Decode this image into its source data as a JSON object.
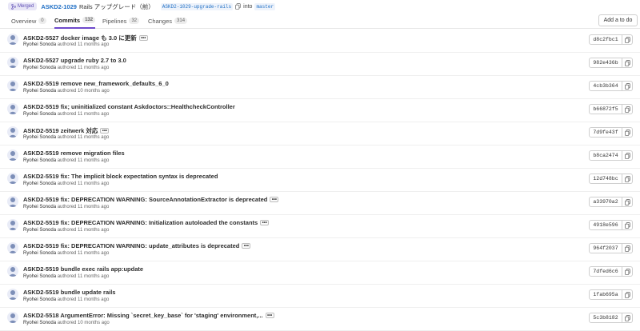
{
  "header": {
    "status_label": "Merged",
    "mr_id": "ASKD2-1029",
    "mr_title": "Rails アップグレード（前）",
    "source_branch": "ASKD2-1029-upgrade-rails",
    "into_label": "into",
    "target_branch": "master"
  },
  "tabs": [
    {
      "label": "Overview",
      "count": "0"
    },
    {
      "label": "Commits",
      "count": "132"
    },
    {
      "label": "Pipelines",
      "count": "32"
    },
    {
      "label": "Changes",
      "count": "314"
    }
  ],
  "todo_button": "Add a to do",
  "commits": [
    {
      "title": "ASKD2-5527 docker image も 3.0 に更新",
      "author": "Ryohei Sonoda",
      "time": "authored 11 months ago",
      "sha": "d8c2fbc1",
      "ellipsis": true
    },
    {
      "title": "ASKD2-5527 upgrade ruby 2.7 to 3.0",
      "author": "Ryohei Sonoda",
      "time": "authored 11 months ago",
      "sha": "982e436b",
      "ellipsis": false
    },
    {
      "title": "ASKD2-5519 remove new_framework_defaults_6_0",
      "author": "Ryohei Sonoda",
      "time": "authored 10 months ago",
      "sha": "4cb3b364",
      "ellipsis": false
    },
    {
      "title": "ASKD2-5519 fix; uninitialized constant Askdoctors::HealthcheckController",
      "author": "Ryohei Sonoda",
      "time": "authored 11 months ago",
      "sha": "b66872f5",
      "ellipsis": false
    },
    {
      "title": "ASKD2-5519 zeitwerk 対応",
      "author": "Ryohei Sonoda",
      "time": "authored 11 months ago",
      "sha": "7d9fe43f",
      "ellipsis": true
    },
    {
      "title": "ASKD2-5519 remove migration files",
      "author": "Ryohei Sonoda",
      "time": "authored 11 months ago",
      "sha": "b8ca2474",
      "ellipsis": false
    },
    {
      "title": "ASKD2-5519 fix: The implicit block expectation syntax is deprecated",
      "author": "Ryohei Sonoda",
      "time": "authored 11 months ago",
      "sha": "12d748bc",
      "ellipsis": false
    },
    {
      "title": "ASKD2-5519 fix: DEPRECATION WARNING: SourceAnnotationExtractor is deprecated",
      "author": "Ryohei Sonoda",
      "time": "authored 11 months ago",
      "sha": "a33970a2",
      "ellipsis": true
    },
    {
      "title": "ASKD2-5519 fix: DEPRECATION WARNING: Initialization autoloaded the constants",
      "author": "Ryohei Sonoda",
      "time": "authored 11 months ago",
      "sha": "4918e596",
      "ellipsis": true
    },
    {
      "title": "ASKD2-5519 fix: DEPRECATION WARNING: update_attributes is deprecated",
      "author": "Ryohei Sonoda",
      "time": "authored 11 months ago",
      "sha": "964f2037",
      "ellipsis": true
    },
    {
      "title": "ASKD2-5519 bundle exec rails app:update",
      "author": "Ryohei Sonoda",
      "time": "authored 11 months ago",
      "sha": "7dfed6c6",
      "ellipsis": false
    },
    {
      "title": "ASKD2-5519 bundle update rails",
      "author": "Ryohei Sonoda",
      "time": "authored 11 months ago",
      "sha": "1fab695a",
      "ellipsis": false
    },
    {
      "title": "ASKD2-5518 ArgumentError: Missing `secret_key_base` for 'staging' environment,...",
      "author": "Ryohei Sonoda",
      "time": "authored 10 months ago",
      "sha": "5c3b8182",
      "ellipsis": true
    }
  ],
  "colors": {
    "accent": "#6e49cb",
    "link": "#1f6fc5",
    "merged_badge": "#e8e6f7"
  },
  "icons": {
    "merged": "merge-icon",
    "copy": "copy-icon",
    "more": "ellipsis-icon",
    "avatar": "user-avatar"
  }
}
